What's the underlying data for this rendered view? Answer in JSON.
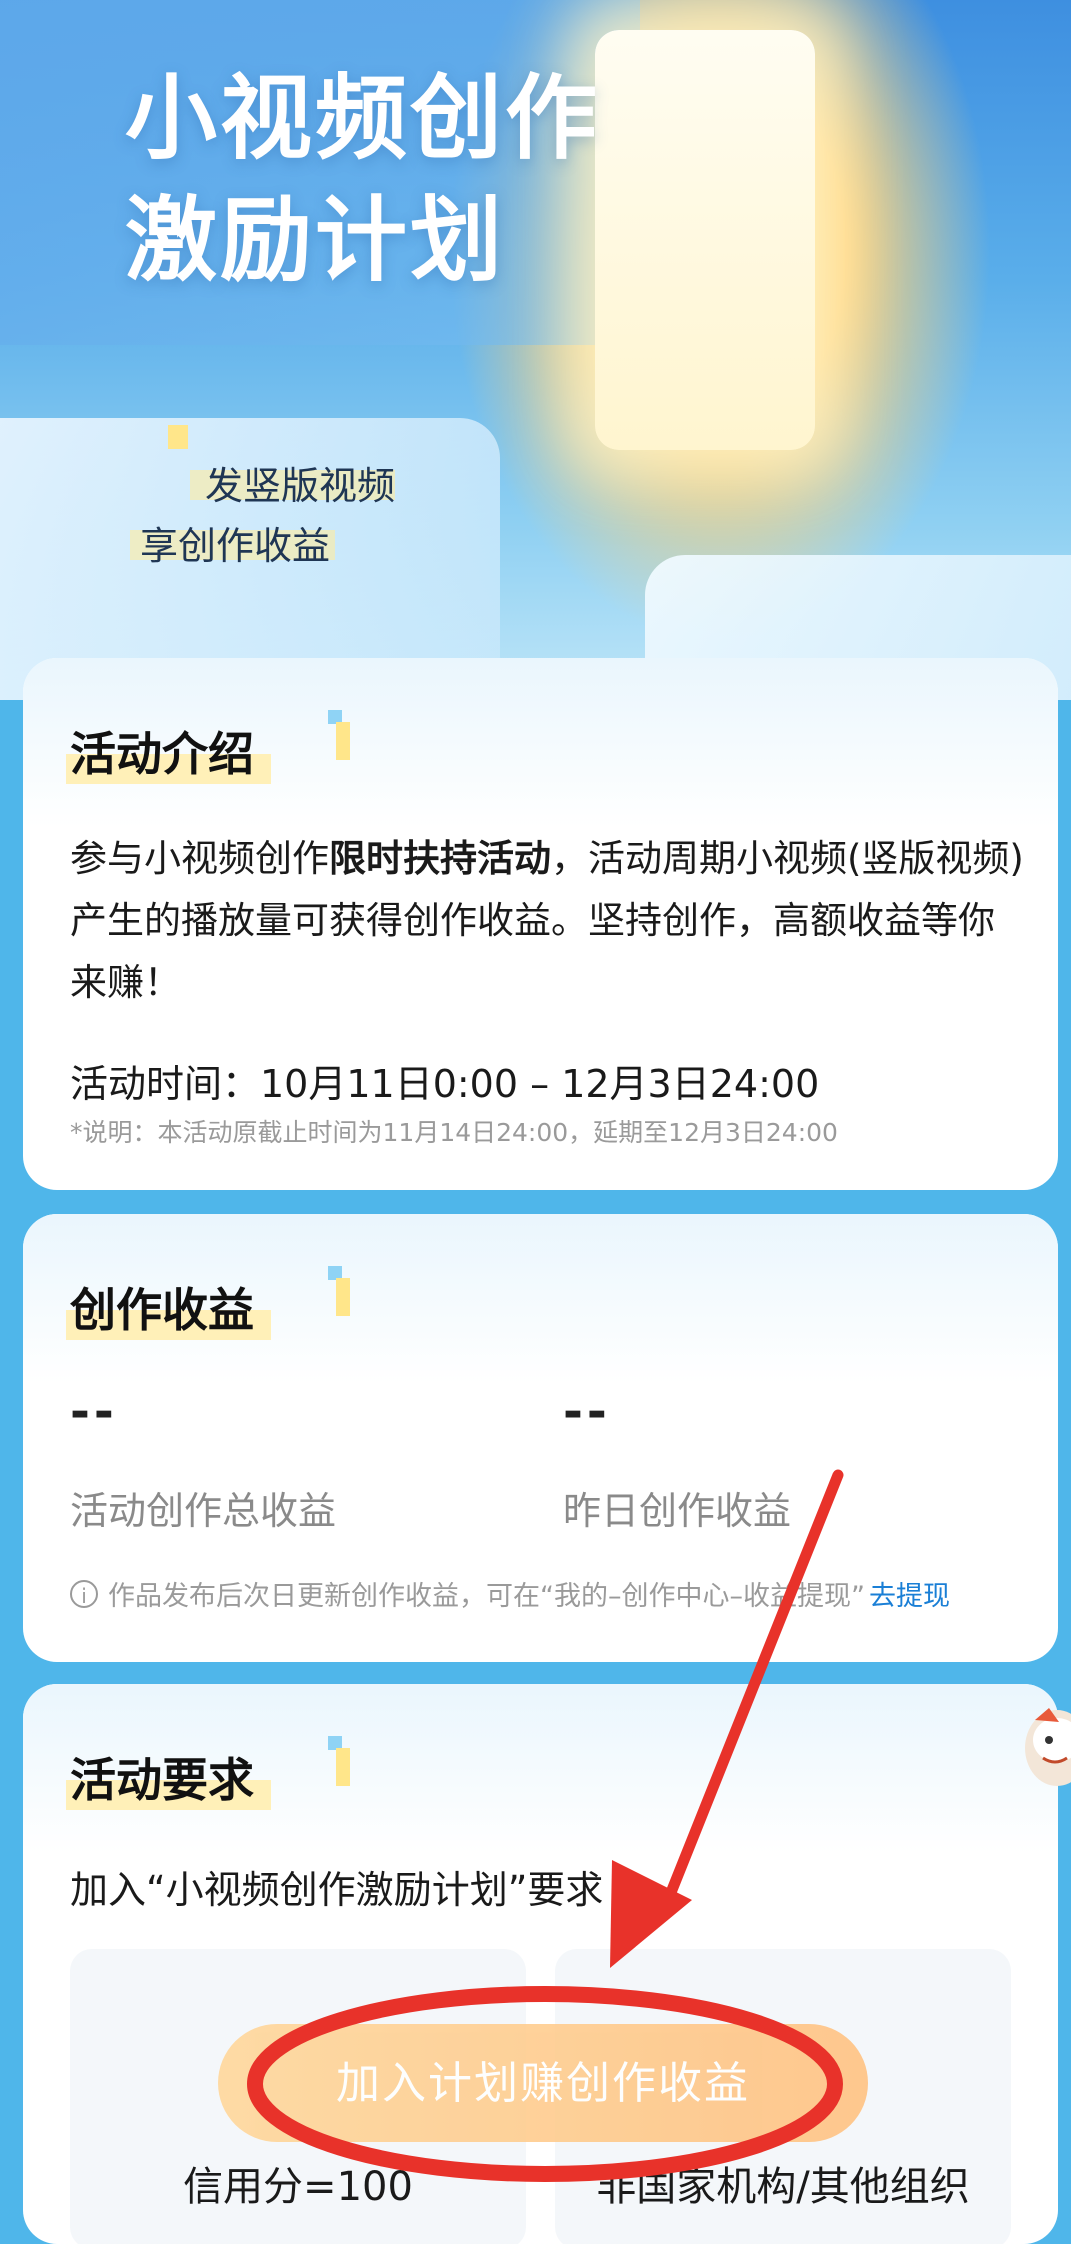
{
  "hero": {
    "title_line1": "小视频创作",
    "title_line2": "激励计划",
    "subtitle_line1": "发竖版视频",
    "subtitle_line2": "享创作收益"
  },
  "intro": {
    "title": "活动介绍",
    "text_before": "参与小视频创作",
    "text_bold": "限时扶持活动",
    "text_after": "，活动周期小视频(竖版视频)产生的播放量可获得创作收益。坚持创作，高额收益等你来赚！",
    "time": "活动时间：10月11日0:00 – 12月3日24:00",
    "note": "*说明：本活动原截止时间为11月14日24:00，延期至12月3日24:00"
  },
  "earnings": {
    "title": "创作收益",
    "total_value": "--",
    "total_label": "活动创作总收益",
    "yesterday_value": "--",
    "yesterday_label": "昨日创作收益",
    "info_icon": "i",
    "info_text": "作品发布后次日更新创作收益，可在“我的–创作中心–收益提现”",
    "info_link": "去提现"
  },
  "requirements": {
    "title": "活动要求",
    "heading": "加入“小视频创作激励计划”要求",
    "left_box": "信用分=100",
    "right_box": "非国家机构/其他组织",
    "join_button": "加入计划赚创作收益"
  },
  "colors": {
    "background": "#4fb6ea",
    "accent_link": "#1a7fd6",
    "button": "#ffc282",
    "annotation_red": "#e8322a"
  },
  "icons": {
    "info": "info-circle-icon",
    "mascot": "mascot-icon"
  }
}
